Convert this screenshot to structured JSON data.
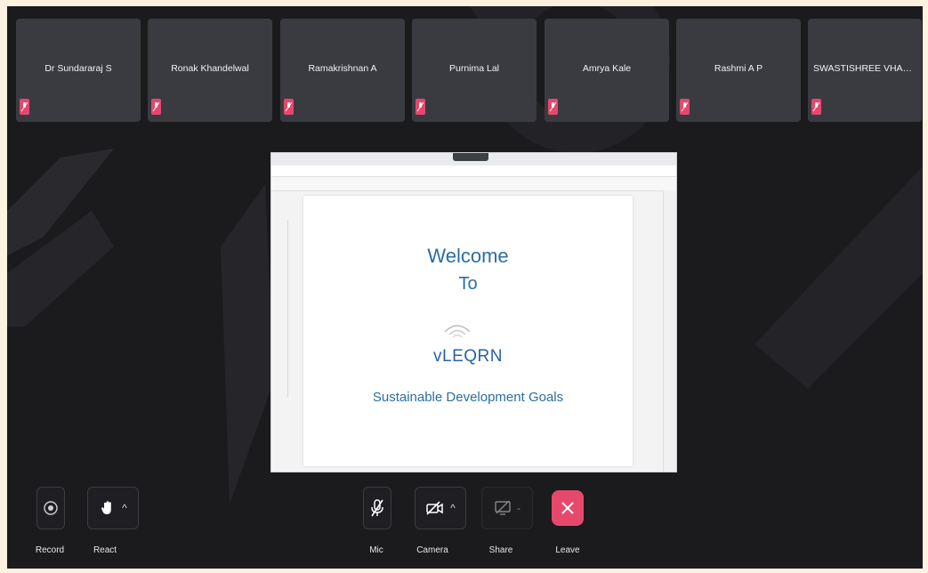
{
  "participants": [
    {
      "name": "Dr Sundararaj S"
    },
    {
      "name": "Ronak Khandelwal"
    },
    {
      "name": "Ramakrishnan A"
    },
    {
      "name": "Purnima Lal"
    },
    {
      "name": "Amrya Kale"
    },
    {
      "name": "Rashmi A P"
    },
    {
      "name": "SWASTISHREE VHANAB..."
    }
  ],
  "shared_screen": {
    "slide": {
      "line1": "Welcome",
      "line2": "To",
      "brand": "vLEQRN",
      "subtitle": "Sustainable Development Goals"
    }
  },
  "controls": {
    "record": "Record",
    "react": "React",
    "mic": "Mic",
    "camera": "Camera",
    "share": "Share",
    "leave": "Leave"
  },
  "colors": {
    "background": "#1b1b1e",
    "tile": "#3a3b40",
    "muted_badge": "#e4486d",
    "leave": "#e7496c",
    "slide_text": "#2b6ea3"
  }
}
